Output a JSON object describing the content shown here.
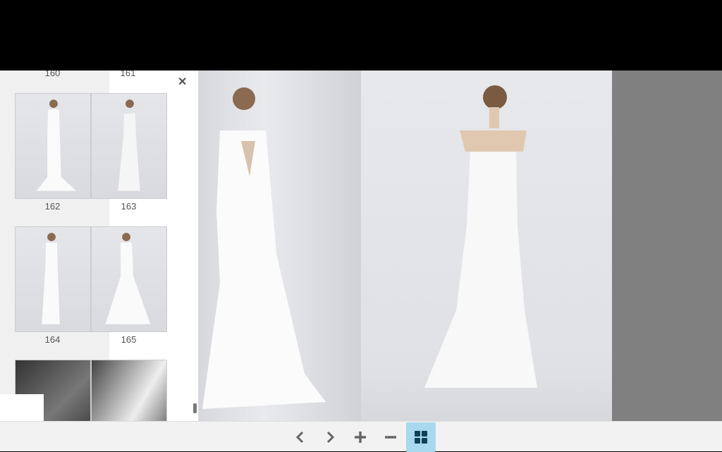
{
  "thumbnails": {
    "top_labels": [
      "160",
      "161"
    ],
    "rows": [
      {
        "pages": [
          "162",
          "163"
        ]
      },
      {
        "pages": [
          "164",
          "165"
        ]
      }
    ]
  },
  "toolbar": {
    "buttons": [
      {
        "icon": "chevron-left-icon"
      },
      {
        "icon": "chevron-right-icon"
      },
      {
        "icon": "zoom-in-icon"
      },
      {
        "icon": "zoom-out-icon"
      },
      {
        "icon": "grid-icon",
        "active": true
      }
    ],
    "active_color": "#a8d8ee"
  }
}
